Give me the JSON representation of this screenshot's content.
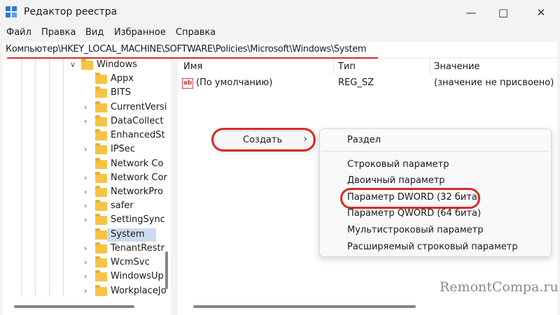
{
  "window": {
    "title": "Редактор реестра"
  },
  "menu": [
    "Файл",
    "Правка",
    "Вид",
    "Избранное",
    "Справка"
  ],
  "address": "Компьютер\\HKEY_LOCAL_MACHINE\\SOFTWARE\\Policies\\Microsoft\\Windows\\System",
  "tree": {
    "parent": "Windows",
    "children": [
      "Appx",
      "BITS",
      "CurrentVersi",
      "DataCollect",
      "EnhancedSt",
      "IPSec",
      "Network Co",
      "Network Cor",
      "NetworkPro",
      "safer",
      "SettingSync",
      "System",
      "TenantRestr",
      "WcmSvc",
      "WindowsUp",
      "WorkplaceJo"
    ],
    "selected": "System"
  },
  "list": {
    "columns": [
      "Имя",
      "Тип",
      "Значение"
    ],
    "rows": [
      {
        "name": "(По умолчанию)",
        "type": "REG_SZ",
        "value": "(значение не присвоено)",
        "icon": "string-value-icon"
      }
    ]
  },
  "context_menu": {
    "create_label": "Создать"
  },
  "submenu": {
    "items": [
      "Раздел",
      "Строковый параметр",
      "Двоичный параметр",
      "Параметр DWORD (32 бита)",
      "Параметр QWORD (64 бита)",
      "Мультистроковый параметр",
      "Расширяемый строковый параметр"
    ],
    "highlighted": "Параметр DWORD (32 бита)"
  },
  "watermark": "RemontCompa.ru",
  "colors": {
    "annotation": "#d42a2a",
    "selection": "#ccdcef",
    "folder": "#f6c445"
  }
}
